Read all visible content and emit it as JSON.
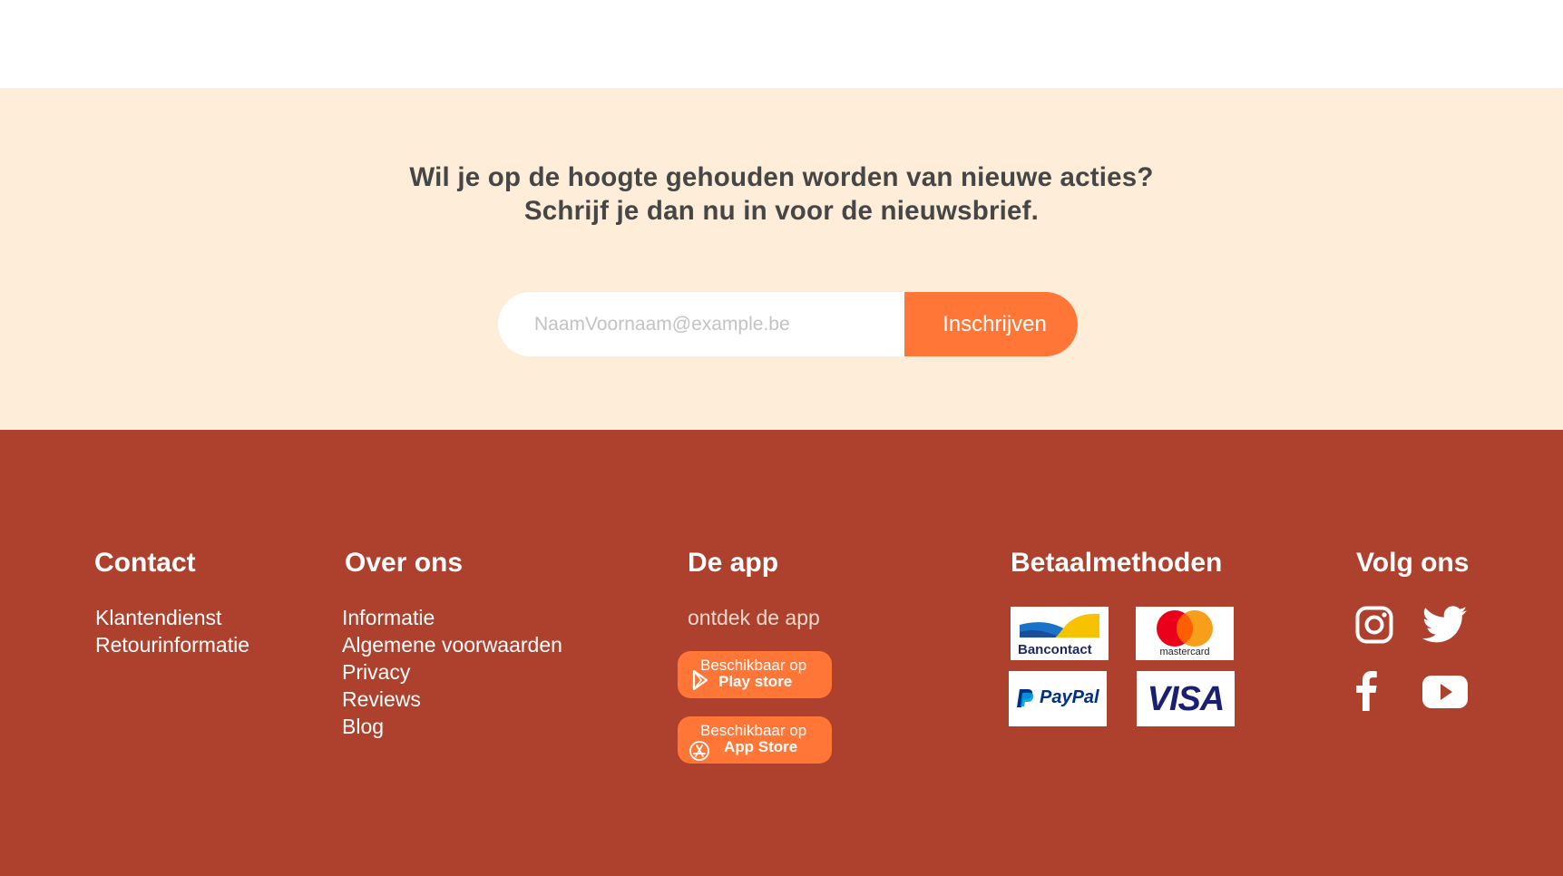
{
  "newsletter": {
    "line1": "Wil je op de hoogte gehouden worden van nieuwe acties?",
    "line2": "Schrijf je dan nu in voor de nieuwsbrief.",
    "email_placeholder": "NaamVoornaam@example.be",
    "email_value": "",
    "subscribe_label": "Inschrijven"
  },
  "footer": {
    "contact": {
      "title": "Contact",
      "links": [
        "Klantendienst",
        "Retourinformatie"
      ]
    },
    "about": {
      "title": "Over ons",
      "links": [
        "Informatie",
        "Algemene voorwaarden",
        "Privacy",
        "Reviews",
        "Blog"
      ]
    },
    "app": {
      "title": "De app",
      "subtitle": "ontdek de app",
      "play_store": {
        "line1": "Beschikbaar op",
        "line2": "Play store",
        "icon": "play-store-icon"
      },
      "app_store": {
        "line1": "Beschikbaar op",
        "line2": "App Store",
        "icon": "app-store-icon"
      }
    },
    "payments": {
      "title": "Betaalmethoden",
      "methods": [
        {
          "name": "Bancontact",
          "text": "Bancontact"
        },
        {
          "name": "Mastercard",
          "text": "mastercard"
        },
        {
          "name": "PayPal",
          "text": "PayPal"
        },
        {
          "name": "Visa",
          "text": "VISA"
        }
      ]
    },
    "social": {
      "title": "Volg ons",
      "icons": [
        "instagram-icon",
        "twitter-icon",
        "facebook-icon",
        "youtube-icon"
      ]
    }
  },
  "colors": {
    "newsletter_bg": "#feedd9",
    "accent_orange": "#ff7637",
    "footer_bg": "#ad412d",
    "heading_text": "#464646"
  }
}
